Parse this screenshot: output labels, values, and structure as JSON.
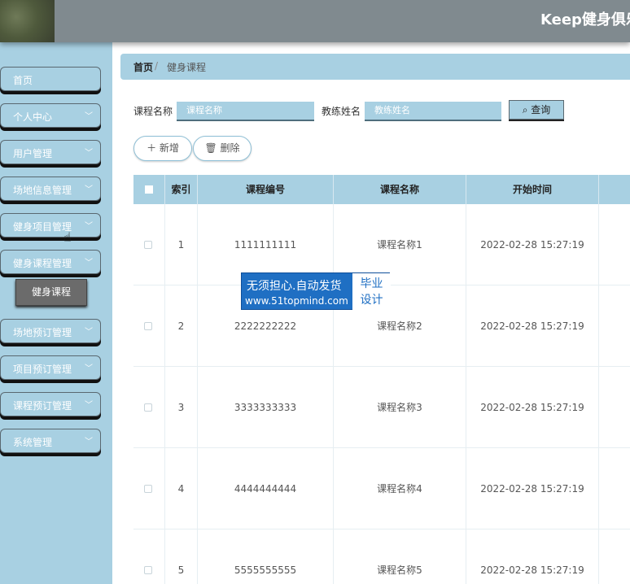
{
  "header": {
    "title": "Keep健身俱乐"
  },
  "sidebar": {
    "items": [
      {
        "label": "首页"
      },
      {
        "label": "个人中心"
      },
      {
        "label": "用户管理"
      },
      {
        "label": "场地信息管理"
      },
      {
        "label": "健身项目管理"
      },
      {
        "label": "健身课程管理"
      },
      {
        "label": "场地预订管理"
      },
      {
        "label": "项目预订管理"
      },
      {
        "label": "课程预订管理"
      },
      {
        "label": "系统管理"
      }
    ],
    "active_sub": "健身课程"
  },
  "breadcrumb": {
    "home": "首页",
    "separator": "/",
    "current": "健身课程"
  },
  "filters": {
    "course_name_label": "课程名称",
    "course_name_placeholder": "课程名称",
    "coach_name_label": "教练姓名",
    "coach_name_placeholder": "教练姓名",
    "search_label": "查询"
  },
  "actions": {
    "add_label": "新增",
    "delete_label": "删除"
  },
  "table": {
    "headers": [
      "索引",
      "课程编号",
      "课程名称",
      "开始时间"
    ],
    "rows": [
      {
        "index": "1",
        "code": "1111111111",
        "name": "课程名称1",
        "start": "2022-02-28 15:27:19"
      },
      {
        "index": "2",
        "code": "2222222222",
        "name": "课程名称2",
        "start": "2022-02-28 15:27:19"
      },
      {
        "index": "3",
        "code": "3333333333",
        "name": "课程名称3",
        "start": "2022-02-28 15:27:19"
      },
      {
        "index": "4",
        "code": "4444444444",
        "name": "课程名称4",
        "start": "2022-02-28 15:27:19"
      },
      {
        "index": "5",
        "code": "5555555555",
        "name": "课程名称5",
        "start": "2022-02-28 15:27:19"
      }
    ]
  },
  "watermark": {
    "line1": "无须担心.自动发货",
    "line2": "www.51topmind.com",
    "side1": "毕业",
    "side2": "设计"
  },
  "colors": {
    "accent": "#a8d0e2",
    "topbar": "#808a8f",
    "watermark": "#1f6fc3"
  }
}
